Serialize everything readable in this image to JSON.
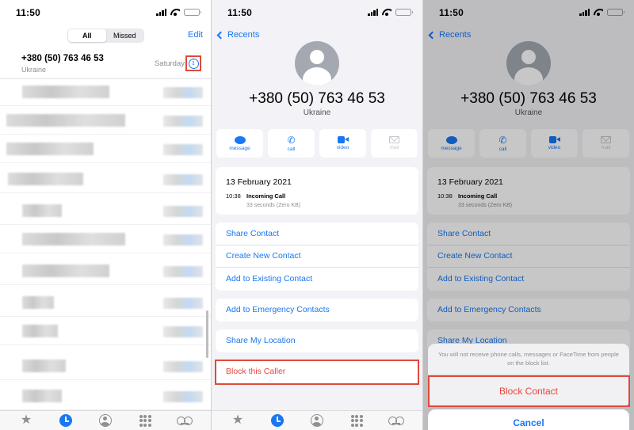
{
  "status": {
    "time": "11:50"
  },
  "recents": {
    "segment": [
      "All",
      "Missed"
    ],
    "edit": "Edit",
    "entry": {
      "number": "+380 (50) 763 46 53",
      "country": "Ukraine",
      "day": "Saturday"
    }
  },
  "contact": {
    "back": "Recents",
    "number": "+380 (50) 763 46 53",
    "country": "Ukraine",
    "actions": [
      "message",
      "call",
      "video",
      "mail"
    ],
    "call": {
      "date": "13 February 2021",
      "time": "10:38",
      "type": "Incoming Call",
      "duration": "33 seconds (Zero KB)"
    },
    "menu": [
      "Share Contact",
      "Create New Contact",
      "Add to Existing Contact"
    ],
    "emergency": "Add to Emergency Contacts",
    "location": "Share My Location",
    "block": "Block this Caller"
  },
  "sheet": {
    "message": "You will not receive phone calls, messages or FaceTime from people on the block list.",
    "block": "Block Contact",
    "cancel": "Cancel"
  },
  "colors": {
    "accent": "#1977f3",
    "destructive": "#e8453c",
    "highlight": "#e04a3a",
    "battery": "#f5c400"
  },
  "tabs": [
    "star-icon",
    "clock-icon",
    "contact-icon",
    "keypad-icon",
    "voicemail-icon"
  ]
}
